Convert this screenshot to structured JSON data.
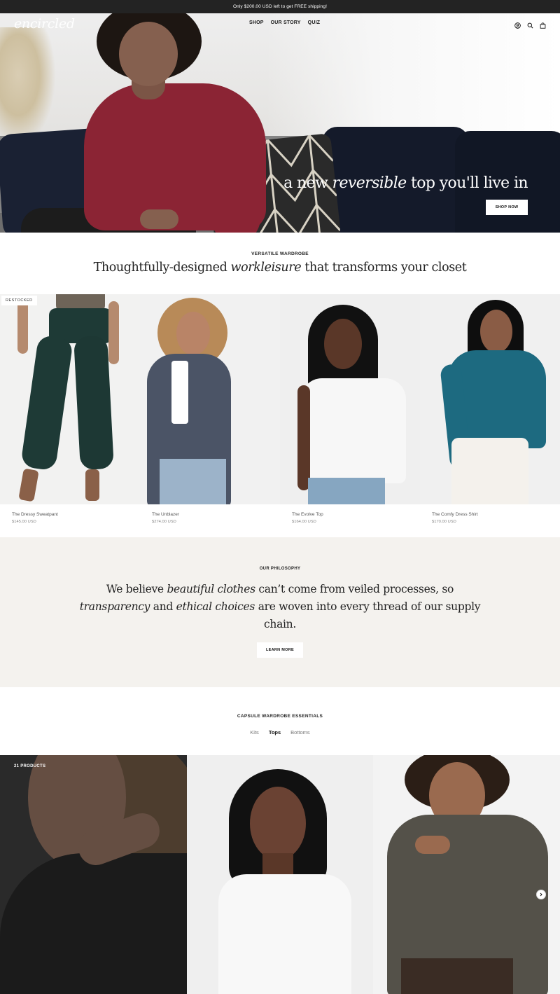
{
  "announcement": "Only $200.00 USD left to get FREE shipping!",
  "header": {
    "logo": "encircled",
    "nav": [
      "SHOP",
      "OUR STORY",
      "QUIZ"
    ],
    "icons": [
      "account-icon",
      "search-icon",
      "bag-icon"
    ]
  },
  "hero": {
    "title_pre": "a new ",
    "title_em": "reversible",
    "title_post": " top you'll live in",
    "button": "SHOP NOW"
  },
  "wardrobe": {
    "eyebrow": "VERSATILE WARDROBE",
    "heading_pre": "Thoughtfully-designed ",
    "heading_em": "workleisure",
    "heading_post": " that transforms your closet",
    "products": [
      {
        "name": "The Dressy Sweatpant",
        "price": "$145.00 USD",
        "badge": "RESTOCKED"
      },
      {
        "name": "The Unblazer",
        "price": "$274.00 USD",
        "badge": ""
      },
      {
        "name": "The Evolve Top",
        "price": "$164.00 USD",
        "badge": ""
      },
      {
        "name": "The Comfy Dress Shirt",
        "price": "$170.00 USD",
        "badge": ""
      }
    ]
  },
  "philosophy": {
    "eyebrow": "OUR PHILOSOPHY",
    "p1": "We believe ",
    "em1": "beautiful clothes",
    "p2": " can’t come from veiled processes, so ",
    "em2": "transparency",
    "p3": " and ",
    "em3": "ethical choices",
    "p4": " are woven into every thread of our supply chain.",
    "button": "LEARN MORE"
  },
  "capsule": {
    "eyebrow": "CAPSULE WARDROBE ESSENTIALS",
    "tabs": [
      "Kits",
      "Tops",
      "Bottoms"
    ],
    "active_tab": "Tops",
    "count": "21 PRODUCTS"
  },
  "colors": {
    "announcement_bg": "#232323",
    "philosophy_bg": "#f4f2ee"
  }
}
